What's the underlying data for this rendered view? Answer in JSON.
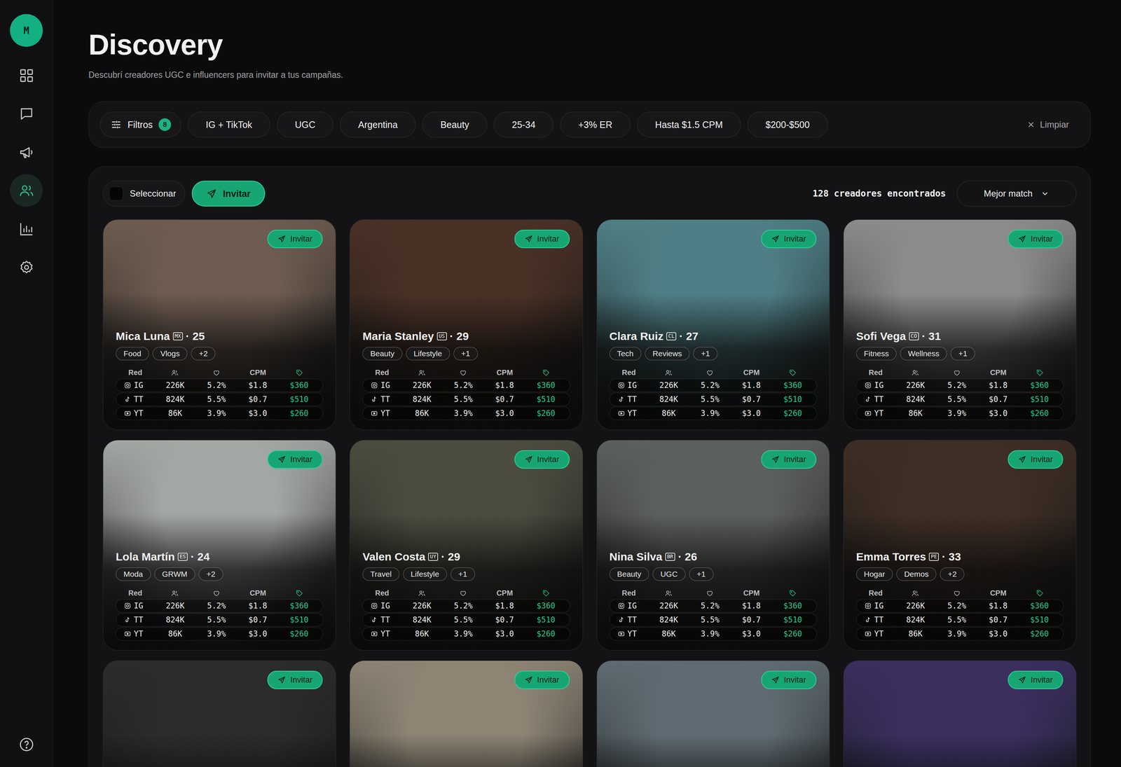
{
  "sidebar": {
    "avatar": "M",
    "nav": [
      {
        "selected": false
      },
      {
        "selected": false
      },
      {
        "selected": false
      },
      {
        "selected": true
      },
      {
        "selected": false
      },
      {
        "selected": false
      }
    ]
  },
  "header": {
    "title": "Discovery",
    "subtitle": "Descubrí creadores UGC e influencers para invitar a tus campañas."
  },
  "filters": {
    "button": "Filtros",
    "count": "8",
    "chips": [
      "IG + TikTok",
      "UGC",
      "Argentina",
      "Beauty",
      "25-34",
      "+3% ER",
      "Hasta $1.5 CPM",
      "$200-$500"
    ],
    "clear": "Limpiar"
  },
  "toolbar": {
    "select": {
      "label": "Seleccionar",
      "checked": false
    },
    "invite": "Invitar",
    "count": "128 creadores encontrados",
    "sort": "Mejor match"
  },
  "table_header": {
    "network": "Red",
    "price": "CPM"
  },
  "cards": [
    {
      "kind": "full",
      "invite": "Invitar",
      "name": "Mica Luna",
      "flag": "MX",
      "age": "· 25",
      "tags": [
        "Food",
        "Vlogs",
        "+2"
      ],
      "color": "#6e5c50",
      "stats": [
        {
          "network": "IG",
          "followers": "226K",
          "er": "5.2%",
          "cpm": "$1.8",
          "price": "$360"
        },
        {
          "network": "TT",
          "followers": "824K",
          "er": "5.5%",
          "cpm": "$0.7",
          "price": "$510"
        },
        {
          "network": "YT",
          "followers": "86K",
          "er": "3.9%",
          "cpm": "$3.0",
          "price": "$260"
        }
      ]
    },
    {
      "kind": "full",
      "invite": "Invitar",
      "name": "Maria Stanley",
      "flag": "US",
      "age": "· 29",
      "tags": [
        "Beauty",
        "Lifestyle",
        "+1"
      ],
      "color": "#4a3126",
      "stats": [
        {
          "network": "IG",
          "followers": "226K",
          "er": "5.2%",
          "cpm": "$1.8",
          "price": "$360"
        },
        {
          "network": "TT",
          "followers": "824K",
          "er": "5.5%",
          "cpm": "$0.7",
          "price": "$510"
        },
        {
          "network": "YT",
          "followers": "86K",
          "er": "3.9%",
          "cpm": "$3.0",
          "price": "$260"
        }
      ]
    },
    {
      "kind": "full",
      "invite": "Invitar",
      "name": "Clara Ruiz",
      "flag": "CL",
      "age": "· 27",
      "tags": [
        "Tech",
        "Reviews",
        "+1"
      ],
      "color": "#4f7f86",
      "stats": [
        {
          "network": "IG",
          "followers": "226K",
          "er": "5.2%",
          "cpm": "$1.8",
          "price": "$360"
        },
        {
          "network": "TT",
          "followers": "824K",
          "er": "5.5%",
          "cpm": "$0.7",
          "price": "$510"
        },
        {
          "network": "YT",
          "followers": "86K",
          "er": "3.9%",
          "cpm": "$3.0",
          "price": "$260"
        }
      ]
    },
    {
      "kind": "full",
      "invite": "Invitar",
      "name": "Sofi Vega",
      "flag": "CO",
      "age": "· 31",
      "tags": [
        "Fitness",
        "Wellness",
        "+1"
      ],
      "color": "#8c8c8c",
      "stats": [
        {
          "network": "IG",
          "followers": "226K",
          "er": "5.2%",
          "cpm": "$1.8",
          "price": "$360"
        },
        {
          "network": "TT",
          "followers": "824K",
          "er": "5.5%",
          "cpm": "$0.7",
          "price": "$510"
        },
        {
          "network": "YT",
          "followers": "86K",
          "er": "3.9%",
          "cpm": "$3.0",
          "price": "$260"
        }
      ]
    },
    {
      "kind": "full",
      "invite": "Invitar",
      "name": "Lola Martín",
      "flag": "ES",
      "age": "· 24",
      "tags": [
        "Moda",
        "GRWM",
        "+2"
      ],
      "color": "#a3a7a4",
      "stats": [
        {
          "network": "IG",
          "followers": "226K",
          "er": "5.2%",
          "cpm": "$1.8",
          "price": "$360"
        },
        {
          "network": "TT",
          "followers": "824K",
          "er": "5.5%",
          "cpm": "$0.7",
          "price": "$510"
        },
        {
          "network": "YT",
          "followers": "86K",
          "er": "3.9%",
          "cpm": "$3.0",
          "price": "$260"
        }
      ]
    },
    {
      "kind": "full",
      "invite": "Invitar",
      "name": "Valen Costa",
      "flag": "UY",
      "age": "· 29",
      "tags": [
        "Travel",
        "Lifestyle",
        "+1"
      ],
      "color": "#4d4c40",
      "stats": [
        {
          "network": "IG",
          "followers": "226K",
          "er": "5.2%",
          "cpm": "$1.8",
          "price": "$360"
        },
        {
          "network": "TT",
          "followers": "824K",
          "er": "5.5%",
          "cpm": "$0.7",
          "price": "$510"
        },
        {
          "network": "YT",
          "followers": "86K",
          "er": "3.9%",
          "cpm": "$3.0",
          "price": "$260"
        }
      ]
    },
    {
      "kind": "full",
      "invite": "Invitar",
      "name": "Nina Silva",
      "flag": "BR",
      "age": "· 26",
      "tags": [
        "Beauty",
        "UGC",
        "+1"
      ],
      "color": "#5c605e",
      "stats": [
        {
          "network": "IG",
          "followers": "226K",
          "er": "5.2%",
          "cpm": "$1.8",
          "price": "$360"
        },
        {
          "network": "TT",
          "followers": "824K",
          "er": "5.5%",
          "cpm": "$0.7",
          "price": "$510"
        },
        {
          "network": "YT",
          "followers": "86K",
          "er": "3.9%",
          "cpm": "$3.0",
          "price": "$260"
        }
      ]
    },
    {
      "kind": "full",
      "invite": "Invitar",
      "name": "Emma Torres",
      "flag": "PE",
      "age": "· 33",
      "tags": [
        "Hogar",
        "Demos",
        "+2"
      ],
      "color": "#3e2e25",
      "stats": [
        {
          "network": "IG",
          "followers": "226K",
          "er": "5.2%",
          "cpm": "$1.8",
          "price": "$360"
        },
        {
          "network": "TT",
          "followers": "824K",
          "er": "5.5%",
          "cpm": "$0.7",
          "price": "$510"
        },
        {
          "network": "YT",
          "followers": "86K",
          "er": "3.9%",
          "cpm": "$3.0",
          "price": "$260"
        }
      ]
    },
    {
      "kind": "clipped",
      "invite": "Invitar",
      "color": "#2c2c2c"
    },
    {
      "kind": "clipped",
      "invite": "Invitar",
      "color": "#8d8474"
    },
    {
      "kind": "clipped",
      "invite": "Invitar",
      "color": "#5f6b72"
    },
    {
      "kind": "clipped",
      "invite": "Invitar",
      "color": "#3b2f60"
    }
  ]
}
